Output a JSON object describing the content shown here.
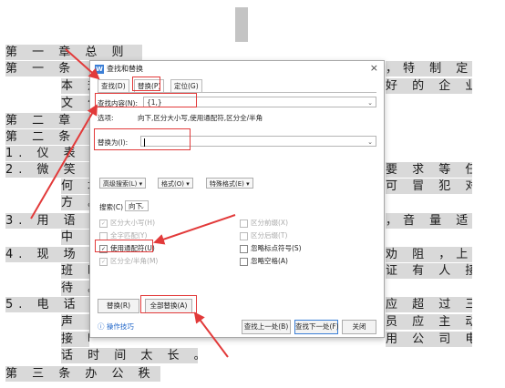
{
  "document": {
    "lines": [
      "第 一 章    总 则",
      "第 一 条",
      "，特 制 定",
      "本 规",
      "好 的 企 业",
      "文 化",
      "第 二 章",
      "第 二 条",
      "1.  仪 表",
      "2.  微 笑",
      "要 求 等 任",
      "何 场",
      "可 冒 犯 对",
      "方 。",
      "3.  用 语",
      "，音 量 适",
      "中 ，",
      "4.  现 场",
      "劝 阻 ，上",
      "班 时",
      "证 有 人 接",
      "待 。",
      "5.  电 话",
      "应 超 过 三",
      "声 ，",
      "员 应 主 动",
      "接 听",
      "用 公 司 电",
      "话 时 间 太 长 。",
      "第 三 条    办 公 秩 序"
    ]
  },
  "dialog": {
    "title": "查找和替换",
    "close": "×",
    "tabs": [
      "查找(D)",
      "替换(P)",
      "定位(G)"
    ],
    "find_label": "查找内容(N):",
    "find_value": "{1,}",
    "options_label": "选项:",
    "options_value": "向下,区分大小写,使用通配符,区分全/半角",
    "replace_label": "替换为(I):",
    "replace_value": "",
    "more_button": "高级搜索(L) ▾",
    "format_button": "格式(O) ▾",
    "special_button": "特殊格式(E) ▾",
    "search_label": "搜索(C)",
    "search_value": "向下",
    "checkboxes_left": [
      {
        "label": "区分大小写(H)",
        "checked": true,
        "disabled": true
      },
      {
        "label": "全字匹配(Y)",
        "checked": false,
        "disabled": true
      },
      {
        "label": "使用通配符(U)",
        "checked": true,
        "disabled": false
      },
      {
        "label": "区分全/半角(M)",
        "checked": true,
        "disabled": true
      }
    ],
    "checkboxes_right": [
      {
        "label": "区分前缀(X)",
        "checked": false,
        "disabled": true
      },
      {
        "label": "区分后缀(T)",
        "checked": false,
        "disabled": true
      },
      {
        "label": "忽略标点符号(S)",
        "checked": false,
        "disabled": false
      },
      {
        "label": "忽略空格(A)",
        "checked": false,
        "disabled": false
      }
    ],
    "replace_button": "替换(R)",
    "replace_all_button": "全部替换(A)",
    "tips_link": "操作技巧",
    "find_prev_button": "查找上一处(B)",
    "find_next_button": "查找下一处(F)",
    "close_button": "关闭"
  },
  "colors": {
    "highlight": "#e23a3a",
    "link": "#1e64c8",
    "doc_bg": "#d9d9d9"
  }
}
